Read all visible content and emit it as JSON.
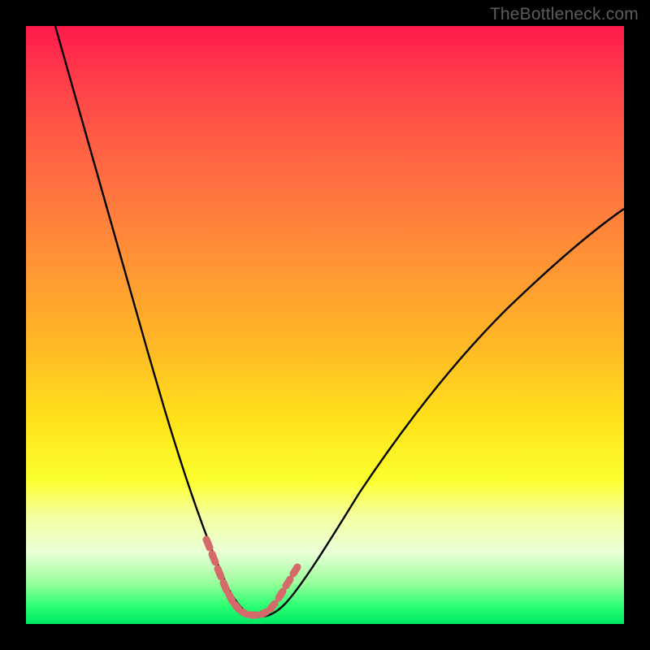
{
  "watermark": {
    "text": "TheBottleneck.com"
  },
  "colors": {
    "page_bg": "#000000",
    "curve_stroke": "#000000",
    "marker_stroke": "#d46a6a",
    "gradient_stops": [
      "#ff1a4d",
      "#ff3a4a",
      "#ff5a46",
      "#ff7a3e",
      "#ff9a33",
      "#ffba25",
      "#ffe21a",
      "#fbff2e",
      "#f4ffa0",
      "#eaffd8",
      "#9cff9d",
      "#2bff72",
      "#00e865"
    ]
  },
  "chart_data": {
    "type": "line",
    "title": "",
    "xlabel": "",
    "ylabel": "",
    "xlim": [
      0,
      100
    ],
    "ylim": [
      0,
      100
    ],
    "grid": false,
    "legend": false,
    "series": [
      {
        "name": "bottleneck-curve",
        "x": [
          5,
          8,
          12,
          16,
          20,
          24,
          27,
          30,
          32,
          34,
          36,
          38,
          40,
          45,
          50,
          55,
          60,
          65,
          70,
          75,
          80,
          85,
          90,
          95,
          100
        ],
        "y": [
          100,
          90,
          78,
          66,
          54,
          42,
          31,
          20,
          12,
          6,
          2,
          1,
          1,
          3,
          8,
          14,
          21,
          28,
          34,
          40,
          46,
          51,
          56,
          60,
          63
        ]
      }
    ],
    "highlight_region": {
      "name": "optimal-range-markers",
      "x": [
        30,
        31,
        32,
        33,
        34,
        35,
        36,
        37,
        38,
        39,
        40,
        41,
        42,
        43,
        44
      ],
      "y": [
        14,
        11,
        8,
        5,
        3,
        2,
        1,
        1,
        1,
        1,
        1,
        2,
        3,
        5,
        7
      ]
    }
  }
}
